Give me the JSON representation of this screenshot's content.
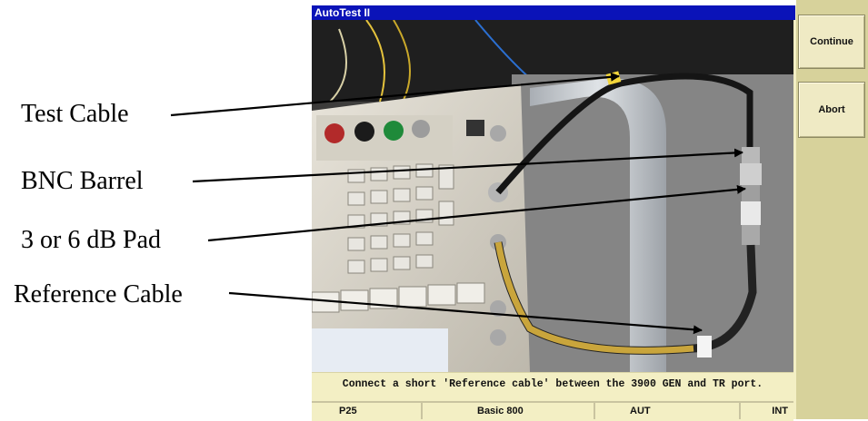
{
  "annotations": [
    {
      "id": "test-cable",
      "label": "Test Cable"
    },
    {
      "id": "bnc-barrel",
      "label": "BNC Barrel"
    },
    {
      "id": "pad",
      "label": "3 or 6 dB Pad"
    },
    {
      "id": "reference-cable",
      "label": "Reference Cable"
    }
  ],
  "window": {
    "title": "AutoTest II",
    "message": "Connect a short 'Reference cable' between the 3900 GEN and TR port."
  },
  "status": {
    "mode": "P25",
    "profile": "Basic 800",
    "target": "AUT",
    "source": "INT"
  },
  "side_buttons": {
    "continue_label": "Continue",
    "abort_label": "Abort"
  },
  "colors": {
    "titlebar": "#0a13b8",
    "panel": "#f3efc4",
    "side_panel": "#d7d29b"
  }
}
